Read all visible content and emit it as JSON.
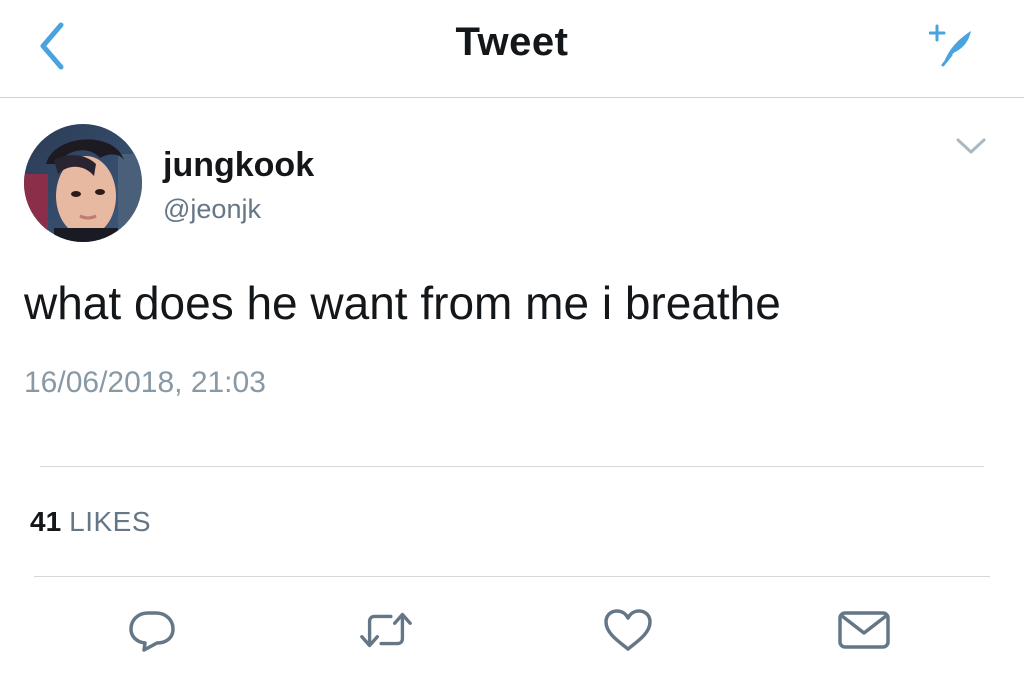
{
  "nav": {
    "back_icon": "chevron-left-icon",
    "title": "Tweet",
    "compose_icon": "compose-tweet-icon",
    "accent_color": "#4aa3df"
  },
  "tweet": {
    "author": {
      "name": "jungkook",
      "handle": "@jeonjk",
      "avatar": "profile-photo"
    },
    "text": "what does he want from me i breathe",
    "timestamp": "16/06/2018, 21:03",
    "stats": {
      "likes_count": "41",
      "likes_label": "LIKES"
    },
    "actions": [
      {
        "name": "reply",
        "icon": "reply-icon"
      },
      {
        "name": "retweet",
        "icon": "retweet-icon"
      },
      {
        "name": "like",
        "icon": "heart-icon"
      },
      {
        "name": "share",
        "icon": "share-envelope-icon"
      }
    ]
  },
  "colors": {
    "text_primary": "#14171a",
    "text_secondary": "#657786",
    "timestamp": "#8899a6",
    "icon_gray": "#657786",
    "divider": "#d4d8db"
  }
}
